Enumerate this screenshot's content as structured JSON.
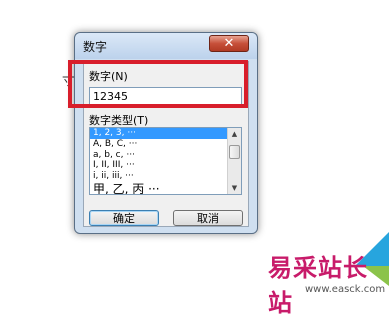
{
  "background_fragment": "寸",
  "dialog": {
    "title": "数字",
    "close_glyph": "✕",
    "number_label": "数字(N)",
    "number_value": "12345",
    "type_label": "数字类型(T)",
    "type_options": [
      "1, 2, 3, ···",
      "A, B, C, ···",
      "a, b, c, ···",
      "I, II, III, ···",
      "i, ii, iii, ···",
      "甲, 乙, 丙 ···"
    ],
    "selected_index": 0,
    "ok_label": "确定",
    "cancel_label": "取消"
  },
  "scrollbar": {
    "up_icon": "▲",
    "down_icon": "▼"
  },
  "watermark": {
    "text": "易采站长站",
    "url": "www.easck.com"
  },
  "colors": {
    "highlight": "#d81e2b",
    "selection": "#3399ff",
    "watermark": "#c81b6a"
  }
}
